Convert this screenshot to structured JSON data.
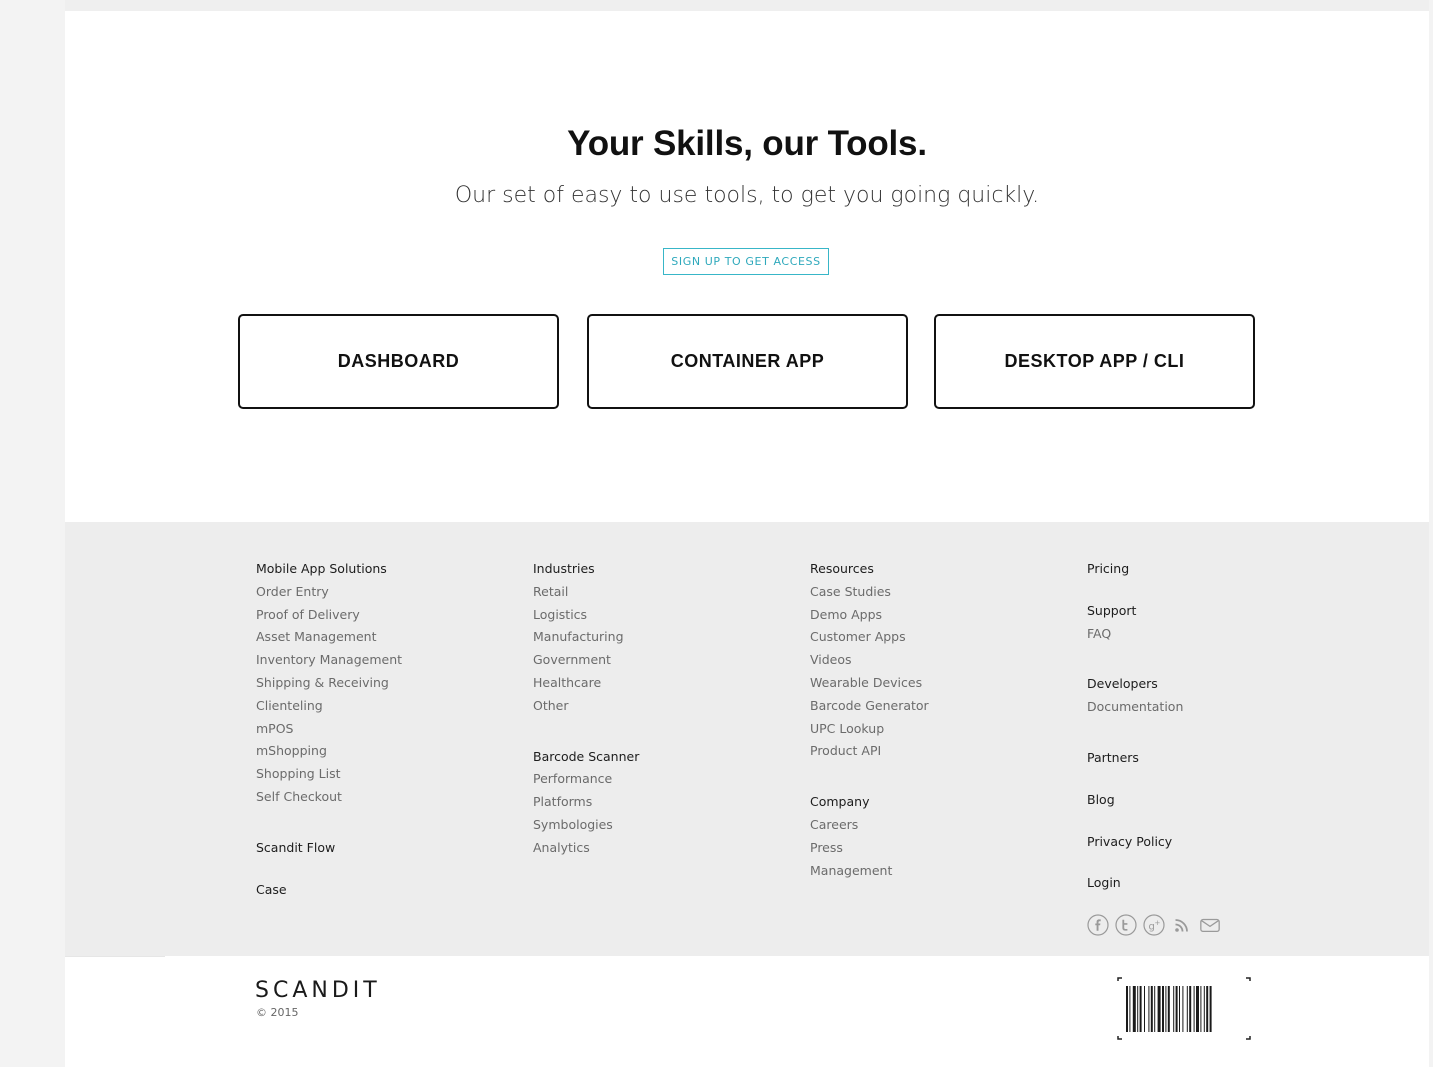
{
  "hero": {
    "title": "Your Skills, our Tools.",
    "subtitle": "Our set of easy to use tools, to get you going quickly.",
    "signup_label": "SIGN UP TO GET ACCESS"
  },
  "tools": [
    {
      "label": "DASHBOARD"
    },
    {
      "label": "CONTAINER APP"
    },
    {
      "label": "DESKTOP APP / CLI"
    }
  ],
  "footer": {
    "col1": {
      "head": "Mobile App Solutions",
      "links": [
        "Order Entry",
        "Proof of Delivery",
        "Asset Management",
        "Inventory Management",
        "Shipping & Receiving",
        "Clienteling",
        "mPOS",
        "mShopping",
        "Shopping List",
        "Self Checkout"
      ],
      "extra1": "Scandit Flow",
      "extra2": "Case"
    },
    "col2": {
      "head": "Industries",
      "links": [
        "Retail",
        "Logistics",
        "Manufacturing",
        "Government",
        "Healthcare",
        "Other"
      ],
      "head2": "Barcode Scanner",
      "links2": [
        "Performance",
        "Platforms",
        "Symbologies",
        "Analytics"
      ]
    },
    "col3": {
      "head": "Resources",
      "links": [
        "Case Studies",
        "Demo Apps",
        "Customer Apps",
        "Videos",
        "Wearable Devices",
        "Barcode Generator",
        "UPC Lookup",
        "Product API"
      ],
      "head2": "Company",
      "links2": [
        "Careers",
        "Press",
        "Management"
      ]
    },
    "col4": {
      "pricing": "Pricing",
      "support": "Support",
      "faq": "FAQ",
      "developers": "Developers",
      "documentation": "Documentation",
      "partners": "Partners",
      "blog": "Blog",
      "privacy": "Privacy Policy",
      "login": "Login"
    },
    "social_icons": [
      "facebook-icon",
      "twitter-icon",
      "google-plus-icon",
      "rss-icon",
      "mail-icon"
    ]
  },
  "bottom": {
    "logo": "SCANDIT",
    "copyright": "© 2015"
  },
  "colors": {
    "accent": "#38b6c8",
    "footer_bg": "#ededed",
    "text_dark": "#111111"
  }
}
